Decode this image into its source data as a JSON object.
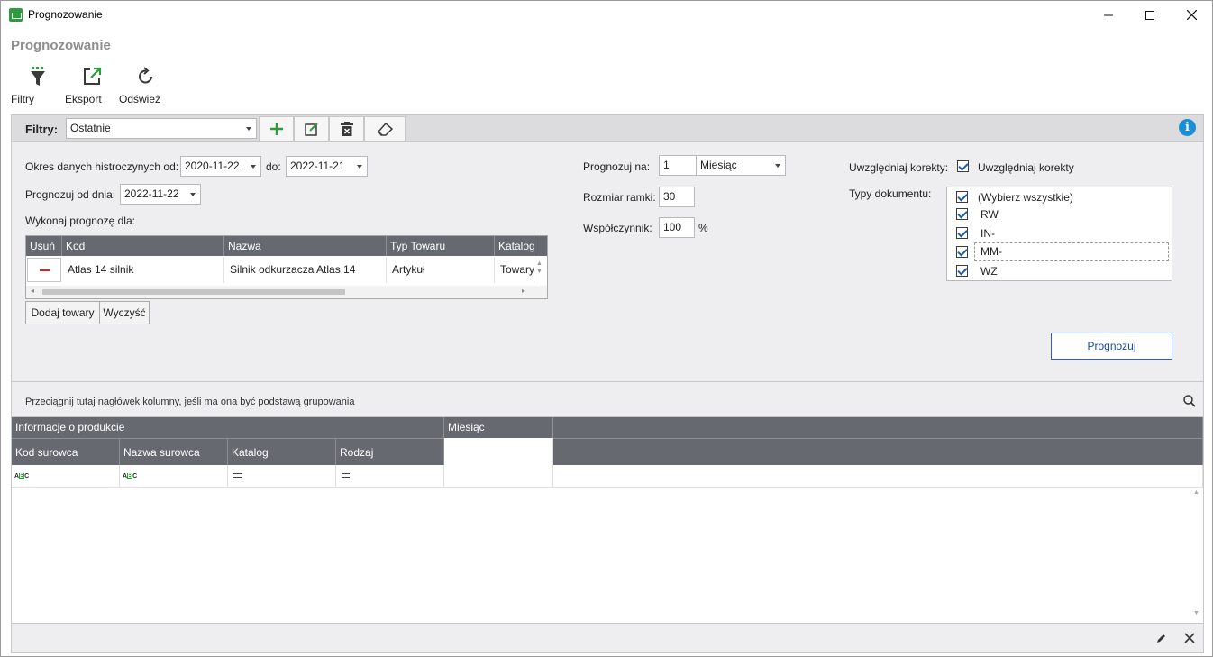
{
  "window": {
    "title": "Prognozowanie"
  },
  "page": {
    "title": "Prognozowanie"
  },
  "ribbon": {
    "filters": "Filtry",
    "export": "Eksport",
    "refresh": "Odśwież"
  },
  "filter_bar": {
    "label": "Filtry:",
    "selected": "Ostatnie"
  },
  "form": {
    "history_label": "Okres danych histroczynych od:",
    "history_from": "2020-11-22",
    "to_label": "do:",
    "history_to": "2022-11-21",
    "forecast_from_label": "Prognozuj od dnia:",
    "forecast_from": "2022-11-22",
    "forecast_for_label": "Wykonaj prognozę dla:",
    "forecast_on_label": "Prognozuj na:",
    "forecast_on_value": "1",
    "forecast_on_unit": "Miesiąc",
    "frame_label": "Rozmiar ramki:",
    "frame_value": "30",
    "factor_label": "Współczynnik:",
    "factor_value": "100",
    "factor_unit": "%",
    "corrections_label": "Uwzględniaj korekty:",
    "corrections_check": "Uwzględniaj korekty",
    "doc_types_label": "Typy dokumentu:",
    "doc_types": [
      "(Wybierz wszystkie)",
      "RW",
      "IN-",
      "MM-",
      "WZ"
    ],
    "add_products": "Dodaj towary",
    "clear": "Wyczyść",
    "forecast_button": "Prognozuj"
  },
  "product_grid": {
    "columns": [
      "Usuń",
      "Kod",
      "Nazwa",
      "Typ Towaru",
      "Katalog"
    ],
    "rows": [
      {
        "kod": "Atlas 14 silnik",
        "nazwa": "Silnik odkurzacza Atlas 14",
        "typ": "Artykuł",
        "katalog": "Towary"
      }
    ]
  },
  "group_panel": {
    "hint": "Przeciągnij tutaj nagłówek kolumny, jeśli ma ona być podstawą grupowania"
  },
  "main_grid": {
    "bands": [
      "Informacje o produkcie",
      "Miesiąc"
    ],
    "columns": [
      "Kod surowca",
      "Nazwa surowca",
      "Katalog",
      "Rodzaj"
    ]
  },
  "icons": [
    "funnel-icon",
    "export-icon",
    "refresh-icon",
    "add-icon",
    "edit-icon",
    "delete-icon",
    "eraser-icon",
    "info-icon",
    "search-icon",
    "pencil-icon",
    "close-icon"
  ],
  "colors": {
    "accent_green": "#2e9c3c",
    "header_gray": "#666a70",
    "info_blue": "#1c8ed6",
    "remove_red": "#d9261c"
  }
}
